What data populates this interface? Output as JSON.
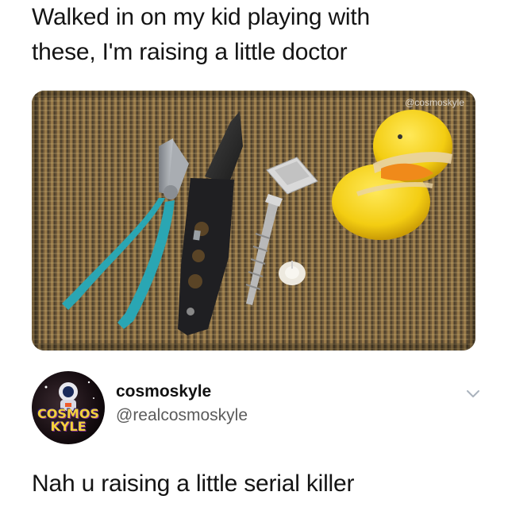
{
  "caption": {
    "line1": "Walked in on my kid playing with",
    "line2": "these, I'm raising a little doctor"
  },
  "photo": {
    "watermark": "@cosmoskyle",
    "objects": [
      "pliers",
      "folding-knife",
      "screw",
      "razor-blade",
      "pushpin",
      "rubber-duck"
    ]
  },
  "tweet": {
    "avatar_text_line1": "COSMOS",
    "avatar_text_line2": "KYLE",
    "display_name": "cosmoskyle",
    "handle": "@realcosmoskyle",
    "chevron_icon": "chevron-down-icon",
    "text": "Nah u raising a little serial killer"
  },
  "colors": {
    "text": "#141414",
    "handle": "#5b5b5b",
    "chevron": "#aab3bd",
    "duck": "#f5d21e",
    "pliers_handle": "#2aa6b3"
  }
}
